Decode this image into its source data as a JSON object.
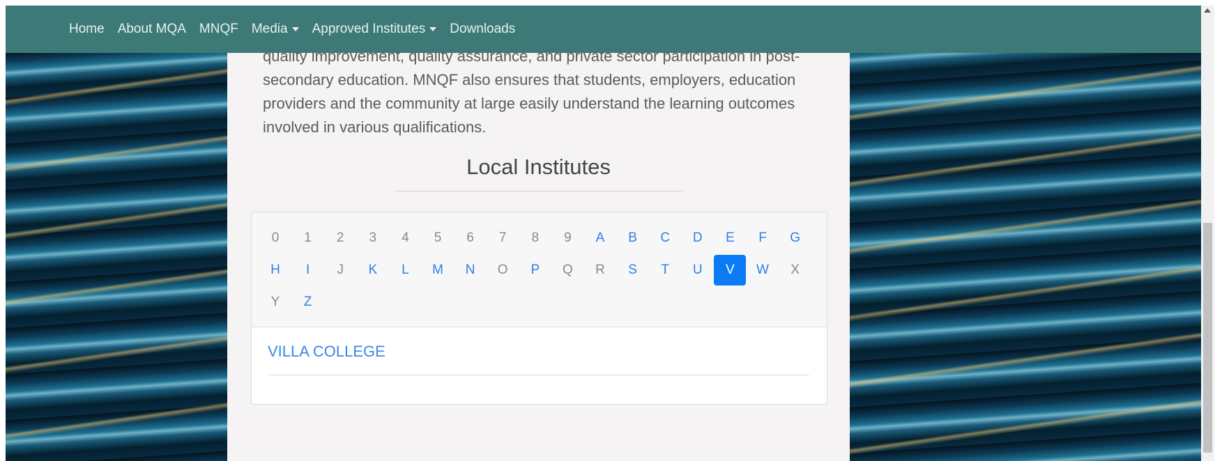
{
  "nav": {
    "items": [
      {
        "label": "Home",
        "dropdown": false
      },
      {
        "label": "About MQA",
        "dropdown": false
      },
      {
        "label": "MNQF",
        "dropdown": false
      },
      {
        "label": "Media",
        "dropdown": true
      },
      {
        "label": "Approved Institutes",
        "dropdown": true
      },
      {
        "label": "Downloads",
        "dropdown": false
      }
    ]
  },
  "intro": {
    "lines": [
      "quality improvement, quality assurance, and private sector participation in post-",
      "secondary education. MNQF also ensures that students, employers, education",
      "providers and the community at large easily understand the learning outcomes",
      "involved in various qualifications."
    ]
  },
  "section": {
    "title": "Local Institutes"
  },
  "alphabet": {
    "letters": [
      {
        "char": "0",
        "state": "disabled"
      },
      {
        "char": "1",
        "state": "disabled"
      },
      {
        "char": "2",
        "state": "disabled"
      },
      {
        "char": "3",
        "state": "disabled"
      },
      {
        "char": "4",
        "state": "disabled"
      },
      {
        "char": "5",
        "state": "disabled"
      },
      {
        "char": "6",
        "state": "disabled"
      },
      {
        "char": "7",
        "state": "disabled"
      },
      {
        "char": "8",
        "state": "disabled"
      },
      {
        "char": "9",
        "state": "disabled"
      },
      {
        "char": "A",
        "state": "enabled"
      },
      {
        "char": "B",
        "state": "enabled"
      },
      {
        "char": "C",
        "state": "enabled"
      },
      {
        "char": "D",
        "state": "enabled"
      },
      {
        "char": "E",
        "state": "enabled"
      },
      {
        "char": "F",
        "state": "enabled"
      },
      {
        "char": "G",
        "state": "enabled"
      },
      {
        "char": "H",
        "state": "enabled"
      },
      {
        "char": "I",
        "state": "enabled"
      },
      {
        "char": "J",
        "state": "disabled"
      },
      {
        "char": "K",
        "state": "enabled"
      },
      {
        "char": "L",
        "state": "enabled"
      },
      {
        "char": "M",
        "state": "enabled"
      },
      {
        "char": "N",
        "state": "enabled"
      },
      {
        "char": "O",
        "state": "disabled"
      },
      {
        "char": "P",
        "state": "enabled"
      },
      {
        "char": "Q",
        "state": "disabled"
      },
      {
        "char": "R",
        "state": "disabled"
      },
      {
        "char": "S",
        "state": "enabled"
      },
      {
        "char": "T",
        "state": "enabled"
      },
      {
        "char": "U",
        "state": "enabled"
      },
      {
        "char": "V",
        "state": "active"
      },
      {
        "char": "W",
        "state": "enabled"
      },
      {
        "char": "X",
        "state": "disabled"
      },
      {
        "char": "Y",
        "state": "disabled"
      },
      {
        "char": "Z",
        "state": "enabled"
      }
    ]
  },
  "results": {
    "institutes": [
      "VILLA COLLEGE"
    ]
  },
  "colors": {
    "navbar": "#3d7a77",
    "active_letter": "#0a7bf5",
    "link": "#3a88e6"
  }
}
